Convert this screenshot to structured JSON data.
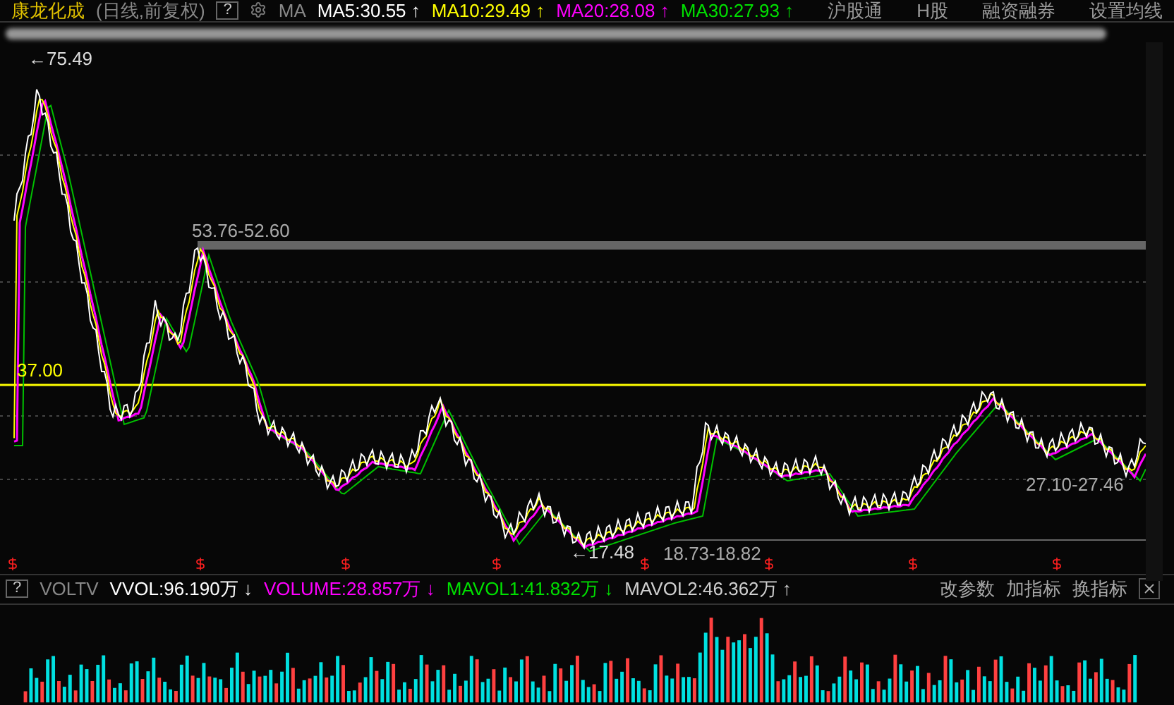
{
  "header": {
    "stock_name": "康龙化成",
    "mode": "(日线,前复权)",
    "help": "?",
    "indicator": "MA",
    "ma_values": [
      {
        "text": "MA5:30.55 ↑",
        "color": "#ffffff"
      },
      {
        "text": "MA10:29.49 ↑",
        "color": "#ffff00"
      },
      {
        "text": "MA20:28.08 ↑",
        "color": "#ff00ff"
      },
      {
        "text": "MA30:27.93 ↑",
        "color": "#00e000"
      }
    ],
    "links": [
      "沪股通",
      "H股",
      "融资融券",
      "设置均线"
    ]
  },
  "price_chart": {
    "high_label": "←75.49",
    "range_label_top": "53.76-52.60",
    "line_label": "37.00",
    "low_label": "←17.48",
    "range_label_bottom": "18.73-18.82",
    "range_label_right": "27.10-27.46"
  },
  "volume_header": {
    "help": "?",
    "indicator": "VOLTV",
    "values": [
      {
        "text": "VVOL:96.190万 ↓",
        "color": "#ffffff"
      },
      {
        "text": "VOLUME:28.857万 ↓",
        "color": "#ff00ff"
      },
      {
        "text": "MAVOL1:41.832万 ↓",
        "color": "#00e000"
      },
      {
        "text": "MAVOL2:46.362万 ↑",
        "color": "#d0d0d0"
      }
    ],
    "buttons": [
      "改参数",
      "加指标",
      "换指标"
    ]
  }
}
